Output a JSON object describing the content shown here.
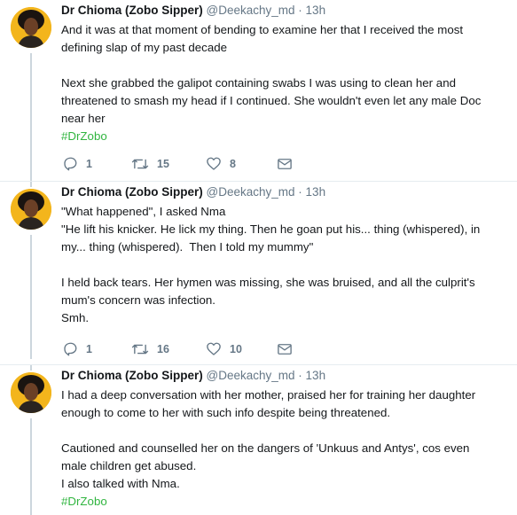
{
  "tweets": [
    {
      "name": "Dr Chioma (Zobo Sipper)",
      "handle": "@Deekachy_md",
      "separator": "·",
      "time": "13h",
      "lines": [
        "And it was at that moment of bending to examine her that I received the most",
        "defining slap of my past decade",
        "",
        "Next she grabbed the galipot containing swabs I was using to clean her and",
        "threatened to smash my head if I continued. She wouldn't even let any male Doc",
        "near her"
      ],
      "hashtag": "#DrZobo",
      "replies": "1",
      "retweets": "15",
      "likes": "8"
    },
    {
      "name": "Dr Chioma (Zobo Sipper)",
      "handle": "@Deekachy_md",
      "separator": "·",
      "time": "13h",
      "lines": [
        "\"What happened\", I asked Nma",
        "\"He lift his knicker. He lick my thing. Then he goan put his... thing (whispered), in",
        "my... thing (whispered).  Then I told my mummy\"",
        "",
        "I held back tears. Her hymen was missing, she was bruised, and all the culprit's",
        "mum's concern was infection.",
        "Smh."
      ],
      "hashtag": "",
      "replies": "1",
      "retweets": "16",
      "likes": "10"
    },
    {
      "name": "Dr Chioma (Zobo Sipper)",
      "handle": "@Deekachy_md",
      "separator": "·",
      "time": "13h",
      "lines": [
        "I had a deep conversation with her mother, praised her for training her daughter",
        "enough to come to her with such info despite being threatened.",
        "",
        "Cautioned and counselled her on the dangers of 'Unkuus and Antys', cos even",
        "male children get abused.",
        "I also talked with Nma."
      ],
      "hashtag": "#DrZobo"
    }
  ],
  "colors": {
    "hashtag": "#31b540",
    "muted": "#657786",
    "thread": "#ccd6dd"
  }
}
